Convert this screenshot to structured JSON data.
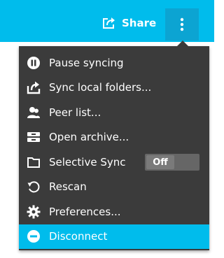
{
  "header": {
    "share_label": "Share"
  },
  "menu": {
    "items": [
      {
        "label": "Pause syncing",
        "icon": "pause-icon"
      },
      {
        "label": "Sync local folders...",
        "icon": "upload-folder-icon"
      },
      {
        "label": "Peer list...",
        "icon": "peers-icon"
      },
      {
        "label": "Open archive...",
        "icon": "archive-icon"
      },
      {
        "label": "Selective Sync",
        "icon": "folder-icon",
        "toggle_value": "Off"
      },
      {
        "label": "Rescan",
        "icon": "rescan-icon"
      },
      {
        "label": "Preferences...",
        "icon": "gear-icon"
      },
      {
        "label": "Disconnect",
        "icon": "disconnect-icon"
      }
    ]
  },
  "colors": {
    "accent": "#00bcec",
    "accent_dark": "#0ca4d2",
    "menu_bg": "#3b3b3b"
  }
}
